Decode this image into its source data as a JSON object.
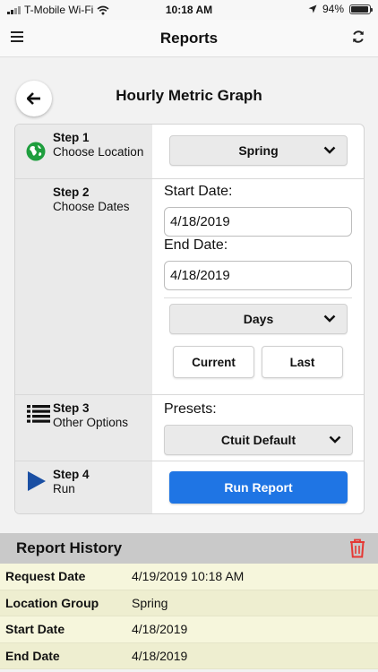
{
  "status_bar": {
    "carrier": "T-Mobile Wi-Fi",
    "time": "10:18 AM",
    "battery": "94%",
    "battery_level": 0.94,
    "icons": [
      "signal-icon",
      "wifi-icon",
      "location-arrow-icon",
      "battery-icon"
    ]
  },
  "header": {
    "title": "Reports",
    "left_icon": "menu-icon",
    "right_icon": "refresh-icon"
  },
  "page": {
    "title": "Hourly Metric Graph",
    "back_icon": "back-arrow-icon"
  },
  "steps": {
    "step1": {
      "number": "Step 1",
      "name": "Choose Location",
      "icon": "globe-icon",
      "dropdown_value": "Spring"
    },
    "step2": {
      "number": "Step 2",
      "name": "Choose Dates",
      "start_label": "Start Date:",
      "start_value": "4/18/2019",
      "end_label": "End Date:",
      "end_value": "4/18/2019",
      "range_value": "Days",
      "current_label": "Current",
      "last_label": "Last"
    },
    "step3": {
      "number": "Step 3",
      "name": "Other Options",
      "icon": "list-icon",
      "presets_label": "Presets:",
      "presets_value": "Ctuit Default"
    },
    "step4": {
      "number": "Step 4",
      "name": "Run",
      "icon": "play-icon",
      "run_label": "Run Report"
    }
  },
  "history": {
    "title": "Report History",
    "delete_icon": "trash-icon",
    "rows": [
      {
        "key": "Request Date",
        "value": "4/19/2019 10:18 AM"
      },
      {
        "key": "Location Group",
        "value": "Spring"
      },
      {
        "key": "Start Date",
        "value": "4/18/2019"
      },
      {
        "key": "End Date",
        "value": "4/18/2019"
      }
    ]
  },
  "colors": {
    "accent_blue": "#1f75e4",
    "globe_green": "#1e9e3e",
    "play_blue": "#1a4fa3",
    "trash_red": "#e53935",
    "history_row": "#f6f6dc"
  }
}
